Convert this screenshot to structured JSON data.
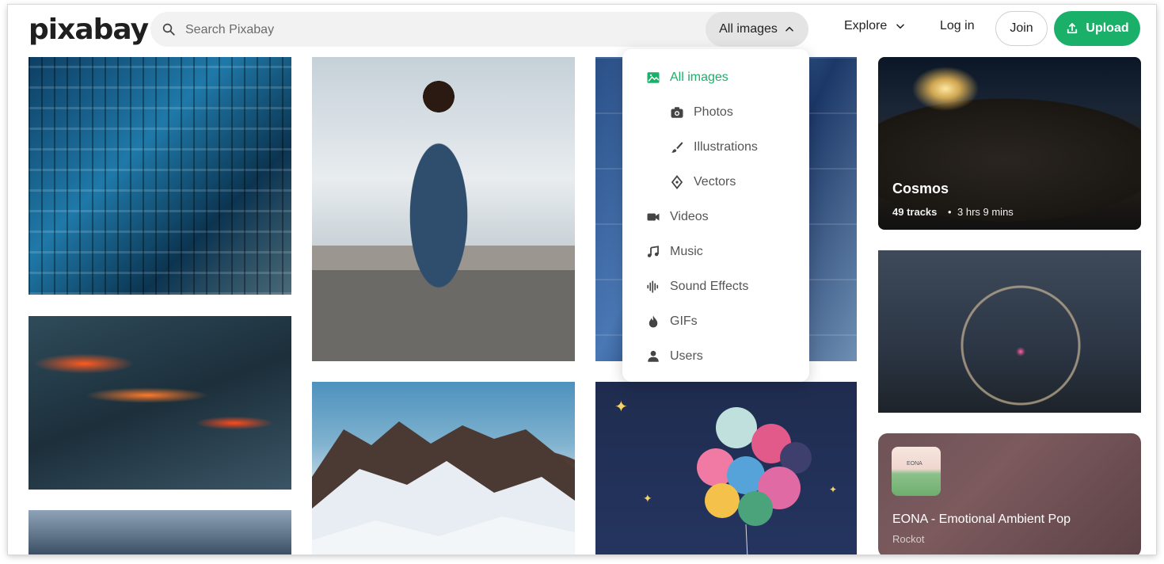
{
  "header": {
    "logo_text": "pixabay",
    "search_placeholder": "Search Pixabay",
    "type_selector_label": "All images",
    "nav_explore": "Explore",
    "nav_login": "Log in",
    "btn_join": "Join",
    "btn_upload": "Upload"
  },
  "dropdown": {
    "items": [
      {
        "label": "All images",
        "icon": "image-icon"
      },
      {
        "label": "Photos",
        "icon": "camera-icon"
      },
      {
        "label": "Illustrations",
        "icon": "brush-icon"
      },
      {
        "label": "Vectors",
        "icon": "pen-nib-icon"
      },
      {
        "label": "Videos",
        "icon": "video-icon"
      },
      {
        "label": "Music",
        "icon": "music-icon"
      },
      {
        "label": "Sound Effects",
        "icon": "waveform-icon"
      },
      {
        "label": "GIFs",
        "icon": "flame-icon"
      },
      {
        "label": "Users",
        "icon": "user-icon"
      }
    ]
  },
  "cards": {
    "cosmos": {
      "title": "Cosmos",
      "tracks": "49 tracks",
      "duration": "3 hrs 9 mins"
    },
    "music": {
      "title": "EONA - Emotional Ambient Pop",
      "artist": "Rockot",
      "thumb_text": "EONA"
    }
  },
  "colors": {
    "brand_green": "#1bb06a"
  }
}
